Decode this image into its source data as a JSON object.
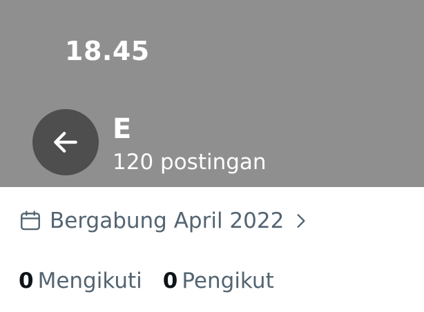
{
  "status_bar": {
    "time": "18.45"
  },
  "header": {
    "back_icon": "arrow-left-icon",
    "name": "E",
    "post_count": "120 postingan",
    "colors": {
      "background": "#8f8f8f",
      "back_button": "#4e4e4e"
    }
  },
  "profile": {
    "joined": {
      "icon": "calendar-icon",
      "text": "Bergabung April 2022",
      "chevron_icon": "chevron-right-icon"
    },
    "following": {
      "count": "0",
      "label": "Mengikuti"
    },
    "followers": {
      "count": "0",
      "label": "Pengikut"
    },
    "colors": {
      "secondary_text": "#536471",
      "primary_text": "#0f1419"
    }
  }
}
